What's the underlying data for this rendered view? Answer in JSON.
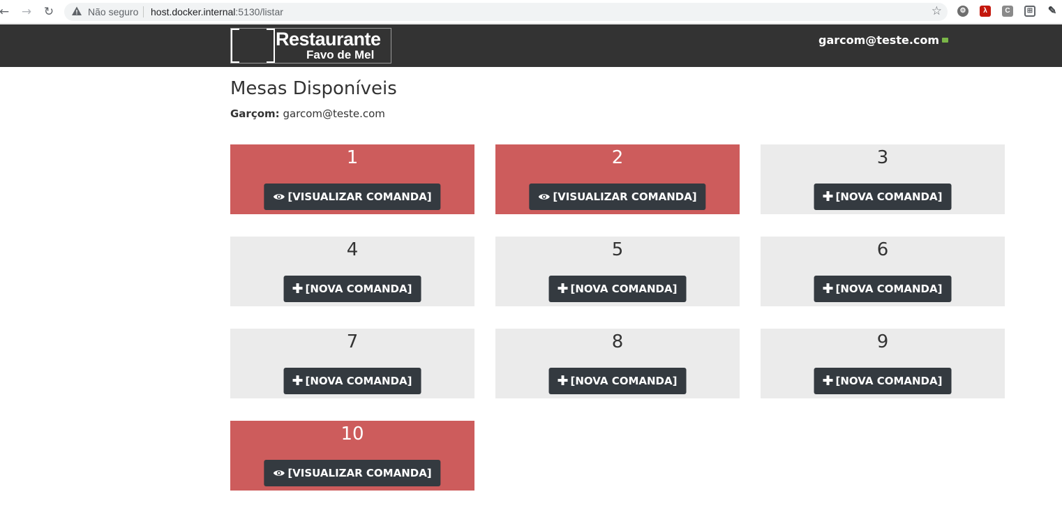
{
  "browser": {
    "back_icon": "arrow-left-icon",
    "forward_icon": "arrow-right-icon",
    "reload_icon": "reload-icon",
    "security_label": "Não seguro",
    "url_host": "host.docker.internal",
    "url_path": ":5130/listar",
    "bookmark_icon": "star-icon",
    "extensions": [
      {
        "icon": "gear-extension-icon",
        "label": "",
        "color": "#6e6e6e"
      },
      {
        "icon": "pdf-extension-icon",
        "label": "",
        "color": "#c4170c"
      },
      {
        "icon": "c-extension-icon",
        "label": "C",
        "color": "#8a8a8a"
      },
      {
        "icon": "grid-extension-icon",
        "label": "",
        "color": "#5f6368"
      },
      {
        "icon": "pencil-icon",
        "label": "",
        "color": "#3c4043"
      }
    ]
  },
  "navbar": {
    "logo_title": "Restaurante",
    "logo_subtitle": "Favo de Mel",
    "user_email": "garcom@teste.com",
    "user_icon": "envelope-check-icon",
    "bg_color": "#333333"
  },
  "main": {
    "title": "Mesas Disponíveis",
    "waiter_label": "Garçom:",
    "waiter_email": "garcom@teste.com"
  },
  "colors": {
    "occupied": "#cd5c5c",
    "free": "#ebebeb",
    "button": "#343a40"
  },
  "tables": [
    {
      "number": "1",
      "status": "occupied",
      "button_label": "[VISUALIZAR COMANDA]",
      "icon": "eye-icon"
    },
    {
      "number": "2",
      "status": "occupied",
      "button_label": "[VISUALIZAR COMANDA]",
      "icon": "eye-icon"
    },
    {
      "number": "3",
      "status": "free",
      "button_label": "[NOVA COMANDA]",
      "icon": "plus-icon"
    },
    {
      "number": "4",
      "status": "free",
      "button_label": "[NOVA COMANDA]",
      "icon": "plus-icon"
    },
    {
      "number": "5",
      "status": "free",
      "button_label": "[NOVA COMANDA]",
      "icon": "plus-icon"
    },
    {
      "number": "6",
      "status": "free",
      "button_label": "[NOVA COMANDA]",
      "icon": "plus-icon"
    },
    {
      "number": "7",
      "status": "free",
      "button_label": "[NOVA COMANDA]",
      "icon": "plus-icon"
    },
    {
      "number": "8",
      "status": "free",
      "button_label": "[NOVA COMANDA]",
      "icon": "plus-icon"
    },
    {
      "number": "9",
      "status": "free",
      "button_label": "[NOVA COMANDA]",
      "icon": "plus-icon"
    },
    {
      "number": "10",
      "status": "occupied",
      "button_label": "[VISUALIZAR COMANDA]",
      "icon": "eye-icon"
    }
  ]
}
